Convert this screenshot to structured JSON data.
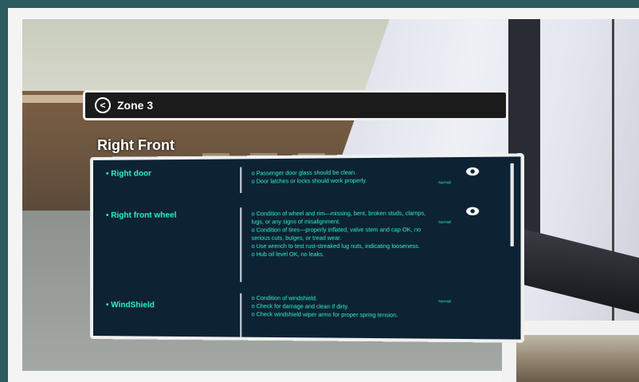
{
  "zone": {
    "title": "Zone 3"
  },
  "section": {
    "title": "Right Front"
  },
  "items": [
    {
      "label": "Right door",
      "lines": [
        "o Passenger door glass should be clean.",
        "o Door latches or locks should work properly."
      ],
      "badge": "Normal",
      "icon": "eye-icon"
    },
    {
      "label": "Right front wheel",
      "lines": [
        "o Condition of wheel and rim—missing, bent, broken studs, clamps, lugs, or any signs of misalignment.",
        "o Condition of tires—properly inflated, valve stem and cap OK, no serious cuts, bulges, or tread wear.",
        "o Use wrench to test rust-streaked lug nuts, indicating looseness.",
        "o Hub oil level OK, no leaks."
      ],
      "badge": "Normal",
      "icon": "eye-icon"
    },
    {
      "label": "WindShield",
      "lines": [
        "o Condition of windshield.",
        "o Check for damage and clean if dirty.",
        "o Check windshield wiper arms for proper spring tension."
      ],
      "badge": "Normal",
      "icon": ""
    }
  ],
  "colors": {
    "accent": "#2ef2c8",
    "panel": "#0d2233",
    "background": "#2c5b5f"
  }
}
